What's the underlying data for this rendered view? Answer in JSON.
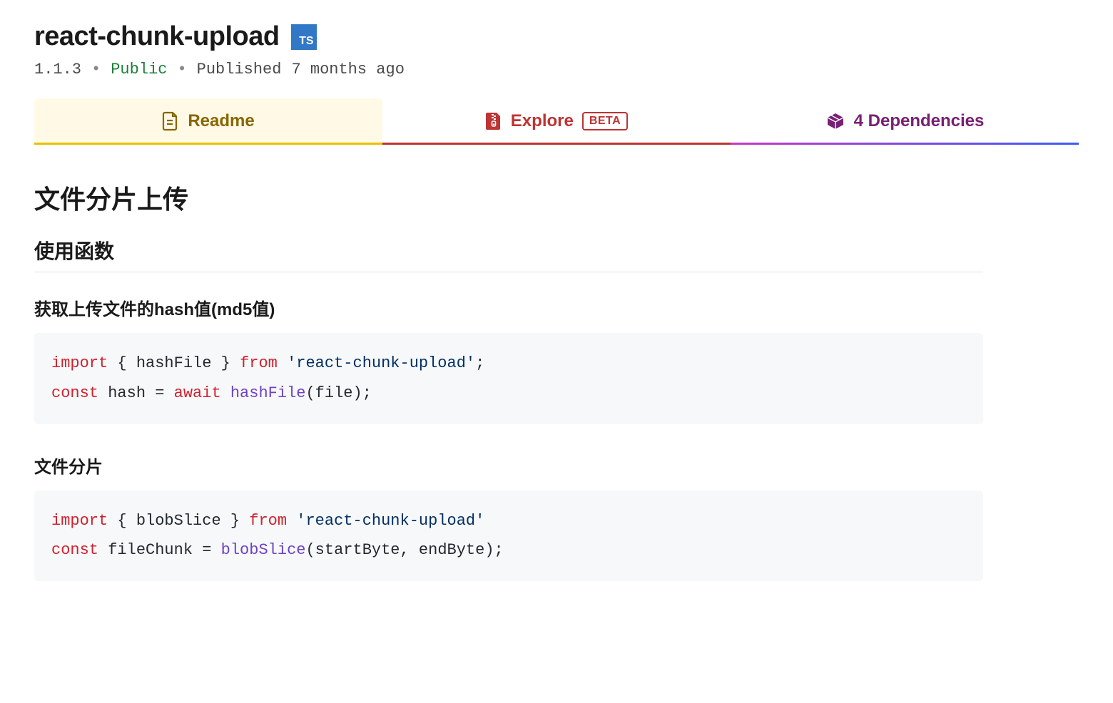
{
  "package": {
    "name": "react-chunk-upload",
    "ts_badge": "TS",
    "version": "1.1.3",
    "visibility": "Public",
    "published_prefix": "Published",
    "published_ago": "7 months ago"
  },
  "tabs": {
    "readme": "Readme",
    "explore": "Explore",
    "explore_beta": "BETA",
    "deps_count": "4",
    "deps_label": "Dependencies"
  },
  "readme": {
    "h1": "文件分片上传",
    "h2": "使用函数",
    "section1_h3": "获取上传文件的hash值(md5值)",
    "section2_h3": "文件分片",
    "code1": {
      "l1_import": "import",
      "l1_braces": " { hashFile } ",
      "l1_from": "from",
      "l1_str": " 'react-chunk-upload'",
      "l1_semi": ";",
      "l2_const": "const",
      "l2_mid": " hash = ",
      "l2_await": "await",
      "l2_sp": " ",
      "l2_fn": "hashFile",
      "l2_call": "(file);"
    },
    "code2": {
      "l1_import": "import",
      "l1_braces": " { blobSlice } ",
      "l1_from": "from",
      "l1_str": " 'react-chunk-upload'",
      "l2_const": "const",
      "l2_mid": " fileChunk = ",
      "l2_fn": "blobSlice",
      "l2_call": "(startByte, endByte);"
    }
  }
}
